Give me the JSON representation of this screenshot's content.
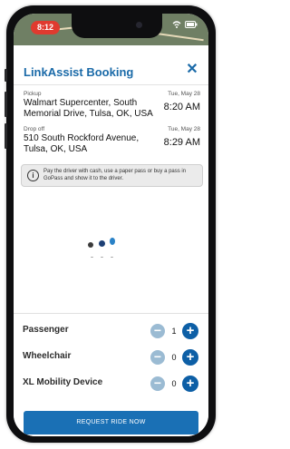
{
  "status_bar": {
    "time": "8:12"
  },
  "header": {
    "title": "LinkAssist Booking",
    "close_icon": "close-icon"
  },
  "pickup": {
    "label": "Pickup",
    "address": "Walmart Supercenter, South Memorial Drive, Tulsa, OK, USA",
    "date": "Tue, May 28",
    "time": "8:20 AM"
  },
  "dropoff": {
    "label": "Drop off",
    "address": "510 South Rockford Avenue, Tulsa, OK, USA",
    "date": "Tue, May 28",
    "time": "8:29 AM"
  },
  "payment_note": {
    "icon": "info-icon",
    "text": "Pay the driver with cash, use a paper pass or buy a pass in GoPass and show it to the driver."
  },
  "loading_indicator": {
    "icon": "loading-dots"
  },
  "counters": [
    {
      "label": "Passenger",
      "value": "1"
    },
    {
      "label": "Wheelchair",
      "value": "0"
    },
    {
      "label": "XL Mobility Device",
      "value": "0"
    }
  ],
  "request_button": {
    "label": "REQUEST RIDE NOW"
  },
  "colors": {
    "primary": "#1a6aa8",
    "button": "#1a70b5",
    "minus_disabled": "#9bbbd3",
    "status_pill": "#e03a2f"
  }
}
